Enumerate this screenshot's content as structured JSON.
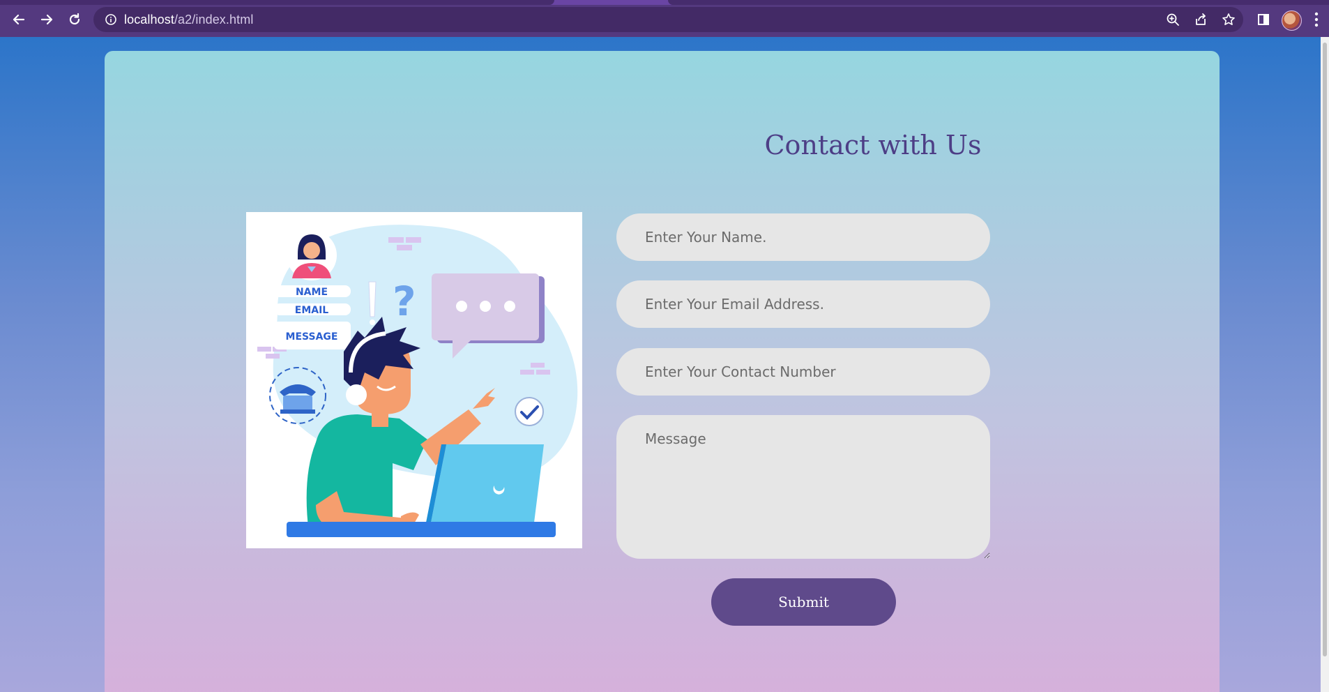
{
  "browser": {
    "url_host": "localhost",
    "url_path": "/a2/index.html",
    "icons": [
      "back-arrow-icon",
      "forward-arrow-icon",
      "reload-icon",
      "info-icon",
      "zoom-icon",
      "share-icon",
      "bookmark-star-icon",
      "side-panel-icon",
      "profile-avatar",
      "kebab-menu-icon"
    ]
  },
  "illustration": {
    "form_labels": [
      "NAME",
      "EMAIL",
      "MESSAGE"
    ]
  },
  "contact_form": {
    "title": "Contact with Us",
    "name_placeholder": "Enter Your Name.",
    "email_placeholder": "Enter Your Email Address.",
    "phone_placeholder": "Enter Your Contact Number",
    "message_placeholder": "Message",
    "submit_label": "Submit"
  },
  "colors": {
    "chrome": "#54397f",
    "title_text": "#4d3e86",
    "submit_button": "#5f4a8b",
    "field_background": "#e6e6e6"
  }
}
